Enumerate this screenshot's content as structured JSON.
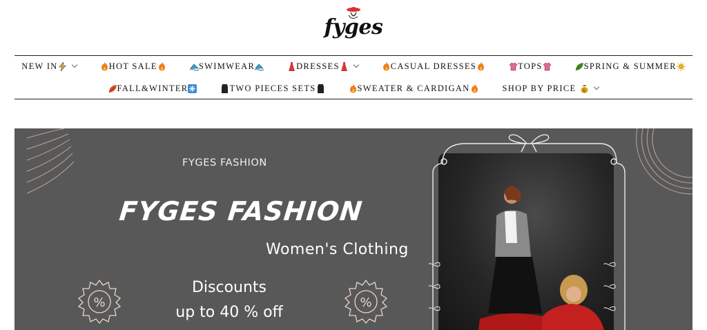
{
  "header": {
    "logo_text": "fyges"
  },
  "nav": {
    "row1": [
      {
        "label": "NEW IN",
        "icon": "lightning-icon",
        "dropdown": true
      },
      {
        "label": "HOT SALE",
        "icon": "fire-icon",
        "dropdown": false
      },
      {
        "label": "SWIMWEAR",
        "icon": "swim-icon",
        "dropdown": false
      },
      {
        "label": "DRESSES",
        "icon": "dress-icon",
        "dropdown": true
      },
      {
        "label": "CASUAL DRESSES",
        "icon": "fire-icon",
        "dropdown": false
      },
      {
        "label": "TOPS",
        "icon": "shirt-icon",
        "dropdown": false
      },
      {
        "label": "SPRING & SUMMER",
        "icon": "leaf-icon",
        "dropdown": false
      }
    ],
    "row2": [
      {
        "label": "FALL&WINTER",
        "icon": "leaf-icon",
        "dropdown": false
      },
      {
        "label": "TWO PIECES SETS",
        "icon": "set-icon",
        "dropdown": false
      },
      {
        "label": "SWEATER & CARDIGAN",
        "icon": "fire-icon",
        "dropdown": false
      },
      {
        "label": "SHOP BY PRICE",
        "icon": "money-bag-icon",
        "dropdown": true
      }
    ]
  },
  "banner": {
    "brand_small": "FYGES FASHION",
    "brand_big": "FYGES FASHION",
    "subtitle": "Women's Clothing",
    "discount_line1": "Discounts",
    "discount_line2": "up to 40 % off"
  },
  "colors": {
    "banner_bg": "#585858",
    "text_white": "#ffffff",
    "fire": "#f07a1a",
    "swim": "#3aa0d8",
    "dress": "#d03a3a",
    "shirt": "#e06a8a",
    "leaf": "#4a8a2a",
    "sun": "#f0b020",
    "snow": "#3a8ad8",
    "set": "#222222",
    "bag": "#d4a020"
  }
}
